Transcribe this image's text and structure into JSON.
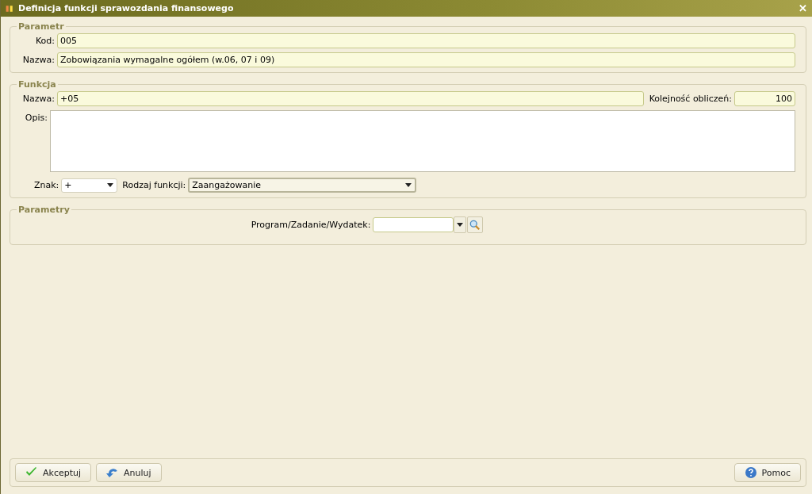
{
  "window": {
    "title": "Definicja funkcji sprawozdania finansowego",
    "close": "✕"
  },
  "parametr": {
    "title": "Parametr",
    "kod_label": "Kod:",
    "kod": "005",
    "nazwa_label": "Nazwa:",
    "nazwa": "Zobowiązania wymagalne ogółem (w.06, 07 i 09)"
  },
  "funkcja": {
    "title": "Funkcja",
    "nazwa_label": "Nazwa:",
    "nazwa": "+05",
    "kolejnosc_label": "Kolejność obliczeń:",
    "kolejnosc": "100",
    "opis_label": "Opis:",
    "znak_label": "Znak:",
    "znak": "+",
    "rodzaj_label": "Rodzaj funkcji:",
    "rodzaj": "Zaangażowanie"
  },
  "parametry": {
    "title": "Parametry",
    "program_label": "Program/Zadanie/Wydatek:"
  },
  "buttons": [
    {
      "kind": "accept",
      "label": "Akceptuj"
    },
    {
      "kind": "cancel",
      "label": "Anuluj"
    },
    {
      "kind": "help",
      "label": "Pomoc"
    }
  ]
}
